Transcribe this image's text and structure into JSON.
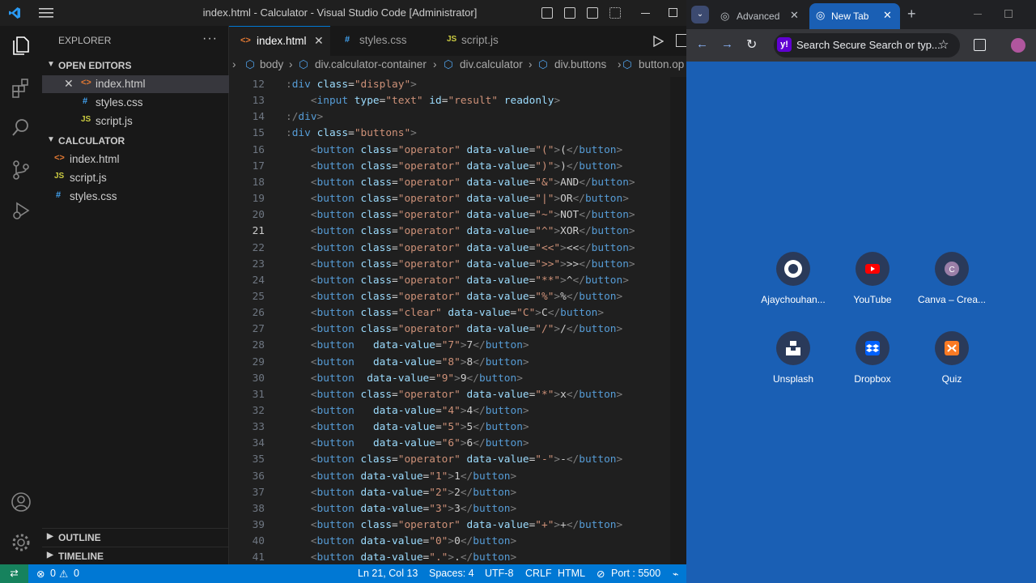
{
  "vscode": {
    "window_title": "index.html - Calculator - Visual Studio Code [Administrator]",
    "explorer": {
      "header": "EXPLORER",
      "open_editors_label": "OPEN EDITORS",
      "open_editors": [
        {
          "name": "index.html",
          "icon": "html-icon",
          "active": true
        },
        {
          "name": "styles.css",
          "icon": "css-icon"
        },
        {
          "name": "script.js",
          "icon": "js-icon"
        }
      ],
      "project_label": "CALCULATOR",
      "files": [
        {
          "name": "index.html",
          "icon": "html-icon"
        },
        {
          "name": "script.js",
          "icon": "js-icon"
        },
        {
          "name": "styles.css",
          "icon": "css-icon"
        }
      ],
      "outline_label": "OUTLINE",
      "timeline_label": "TIMELINE"
    },
    "tabs": [
      {
        "name": "index.html",
        "icon_glyph": "<>",
        "active": true
      },
      {
        "name": "styles.css",
        "icon_glyph": "#"
      },
      {
        "name": "script.js",
        "icon_glyph": "JS"
      }
    ],
    "breadcrumb": [
      "body",
      "div.calculator-container",
      "div.calculator",
      "div.buttons",
      "button.op"
    ],
    "current_line": 21,
    "code_lines": [
      {
        "n": 12,
        "text": ":div class=\"display\">"
      },
      {
        "n": 13,
        "text": "    <input type=\"text\" id=\"result\" readonly>"
      },
      {
        "n": 14,
        "text": ":/div>"
      },
      {
        "n": 15,
        "text": ":div class=\"buttons\">"
      },
      {
        "n": 16,
        "text": "    <button class=\"operator\" data-value=\"(\">(</button>"
      },
      {
        "n": 17,
        "text": "    <button class=\"operator\" data-value=\")\">)</button>"
      },
      {
        "n": 18,
        "text": "    <button class=\"operator\" data-value=\"&\">AND</button>"
      },
      {
        "n": 19,
        "text": "    <button class=\"operator\" data-value=\"|\">OR</button>"
      },
      {
        "n": 20,
        "text": "    <button class=\"operator\" data-value=\"~\">NOT</button>"
      },
      {
        "n": 21,
        "text": "    <button class=\"operator\" data-value=\"^\">XOR</button>"
      },
      {
        "n": 22,
        "text": "    <button class=\"operator\" data-value=\"<<\"><<</button>"
      },
      {
        "n": 23,
        "text": "    <button class=\"operator\" data-value=\">>\">>></button>"
      },
      {
        "n": 24,
        "text": "    <button class=\"operator\" data-value=\"**\">^</button>"
      },
      {
        "n": 25,
        "text": "    <button class=\"operator\" data-value=\"%\">%</button>"
      },
      {
        "n": 26,
        "text": "    <button class=\"clear\" data-value=\"C\">C</button>"
      },
      {
        "n": 27,
        "text": "    <button class=\"operator\" data-value=\"/\">/</button>"
      },
      {
        "n": 28,
        "text": "    <button   data-value=\"7\">7</button>"
      },
      {
        "n": 29,
        "text": "    <button   data-value=\"8\">8</button>"
      },
      {
        "n": 30,
        "text": "    <button  data-value=\"9\">9</button>"
      },
      {
        "n": 31,
        "text": "    <button class=\"operator\" data-value=\"*\">x</button>"
      },
      {
        "n": 32,
        "text": "    <button   data-value=\"4\">4</button>"
      },
      {
        "n": 33,
        "text": "    <button   data-value=\"5\">5</button>"
      },
      {
        "n": 34,
        "text": "    <button   data-value=\"6\">6</button>"
      },
      {
        "n": 35,
        "text": "    <button class=\"operator\" data-value=\"-\">-</button>"
      },
      {
        "n": 36,
        "text": "    <button data-value=\"1\">1</button>"
      },
      {
        "n": 37,
        "text": "    <button data-value=\"2\">2</button>"
      },
      {
        "n": 38,
        "text": "    <button data-value=\"3\">3</button>"
      },
      {
        "n": 39,
        "text": "    <button class=\"operator\" data-value=\"+\">+</button>"
      },
      {
        "n": 40,
        "text": "    <button data-value=\"0\">0</button>"
      },
      {
        "n": 41,
        "text": "    <button data-value=\".\">.</button>"
      }
    ],
    "status": {
      "errors": "0",
      "warnings": "0",
      "position": "Ln 21, Col 13",
      "spaces": "Spaces: 4",
      "encoding": "UTF-8",
      "eol": "CRLF",
      "language": "HTML",
      "port": "Port : 5500"
    }
  },
  "browser": {
    "tabs": [
      {
        "title": "Advanced C",
        "active": false
      },
      {
        "title": "New Tab",
        "active": true
      }
    ],
    "omnibox_placeholder": "Search Secure Search or typ...",
    "shortcuts": [
      {
        "label": "Ajaychouhan...",
        "icon": "github-icon"
      },
      {
        "label": "YouTube",
        "icon": "youtube-icon"
      },
      {
        "label": "Canva – Crea...",
        "icon": "canva-icon"
      },
      {
        "label": "Unsplash",
        "icon": "unsplash-icon"
      },
      {
        "label": "Dropbox",
        "icon": "dropbox-icon"
      },
      {
        "label": "Quiz",
        "icon": "quiz-icon"
      }
    ]
  },
  "colors": {
    "vs_accent": "#0078d4",
    "browser_bg": "#1a5fb4",
    "html_icon": "#e37933",
    "css_icon": "#42a5f5",
    "js_icon": "#cbcb41"
  }
}
